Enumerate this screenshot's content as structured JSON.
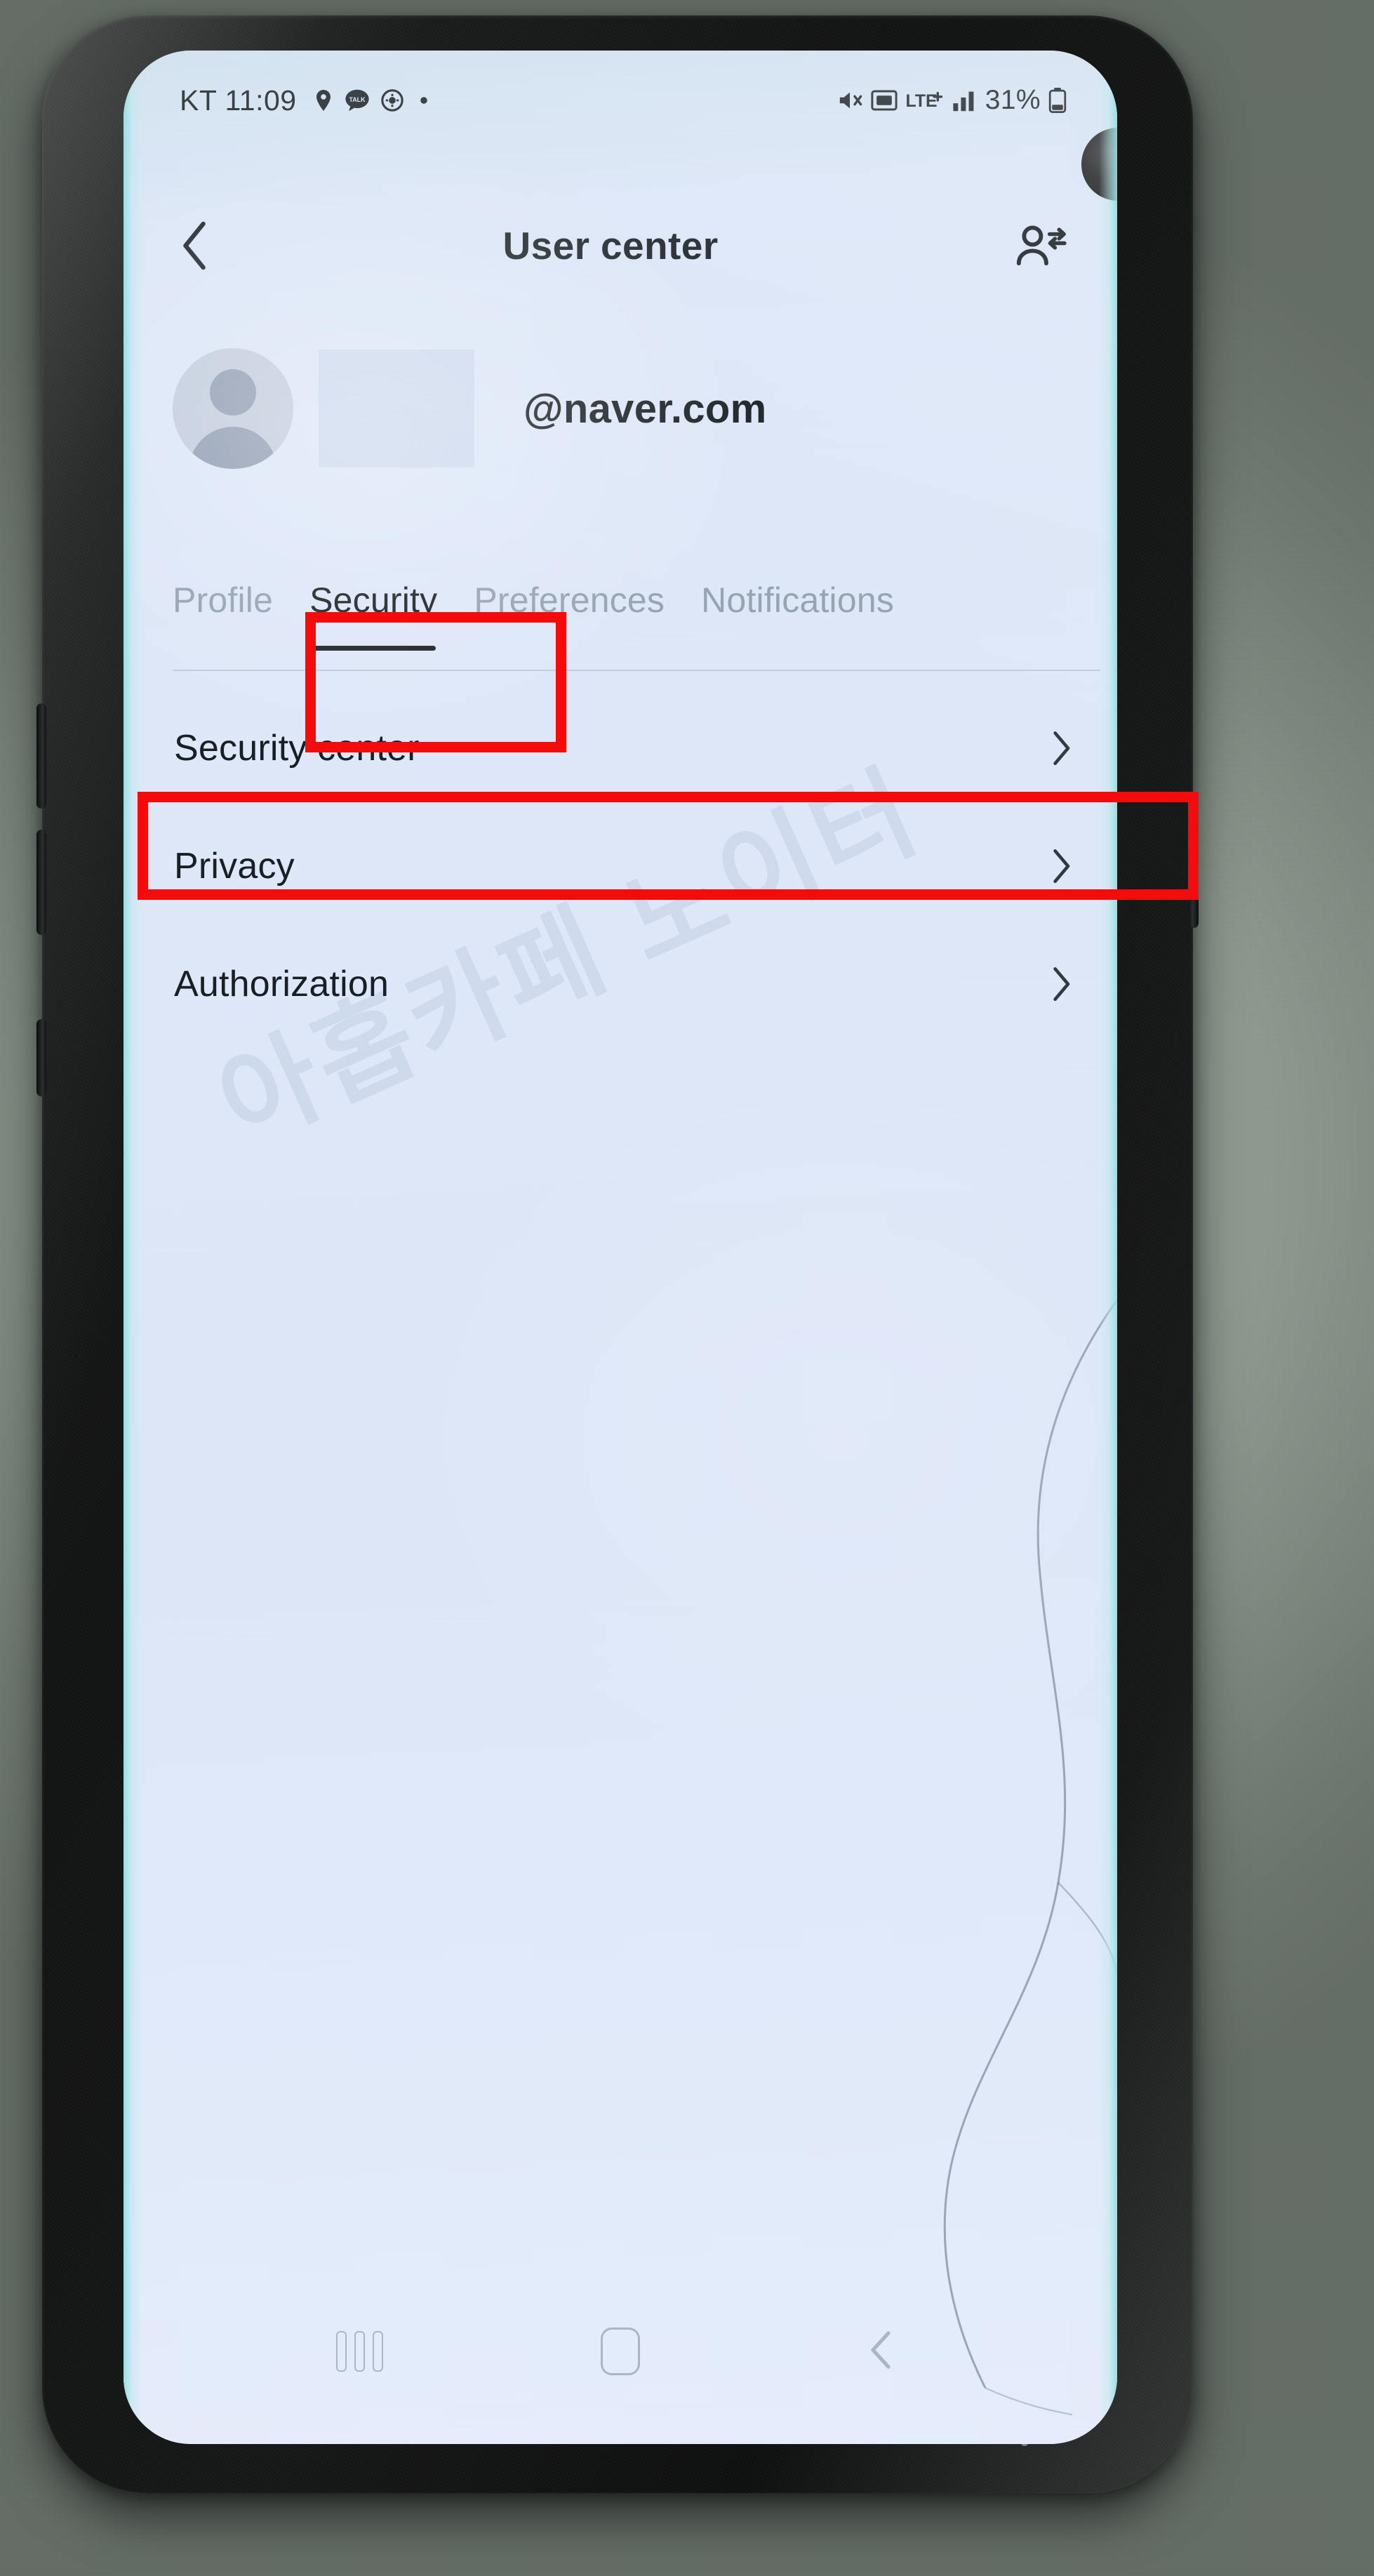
{
  "device": {
    "platform": "android-phone",
    "bezel_color": "#141515",
    "background_color": "#8f9b91"
  },
  "status_bar": {
    "carrier_and_time": "KT 11:09",
    "left_icons": [
      "location-icon",
      "kakaotalk-icon",
      "alarm-icon",
      "dot-icon"
    ],
    "right_icons": [
      "mute-icon",
      "sim-card-icon",
      "lte-plus-icon",
      "signal-bars-icon"
    ],
    "network_label": "LTE",
    "battery_percent": "31%",
    "battery_icon": "battery-icon"
  },
  "header": {
    "back_icon": "chevron-left-icon",
    "title": "User center",
    "action_icon": "switch-account-icon"
  },
  "profile": {
    "avatar_icon": "person-avatar-icon",
    "username_redacted": "",
    "email_domain": "@naver.com"
  },
  "tabs": {
    "active_index": 1,
    "items": [
      {
        "label": "Profile"
      },
      {
        "label": "Security"
      },
      {
        "label": "Preferences"
      },
      {
        "label": "Notifications"
      }
    ]
  },
  "settings_list": {
    "rows": [
      {
        "label": "Security center",
        "chevron": "chevron-right-icon"
      },
      {
        "label": "Privacy",
        "chevron": "chevron-right-icon"
      },
      {
        "label": "Authorization",
        "chevron": "chevron-right-icon"
      }
    ]
  },
  "watermark": {
    "text": "아홉카페 노이터"
  },
  "navigation_bar": {
    "recents_icon": "recents-icon",
    "home_icon": "home-icon",
    "back_icon": "nav-back-icon"
  },
  "annotations": {
    "color": "#f40b0b",
    "boxes": [
      {
        "target": "tab-security",
        "label": "Security"
      },
      {
        "target": "row-security-center",
        "label": "Security center"
      }
    ]
  }
}
